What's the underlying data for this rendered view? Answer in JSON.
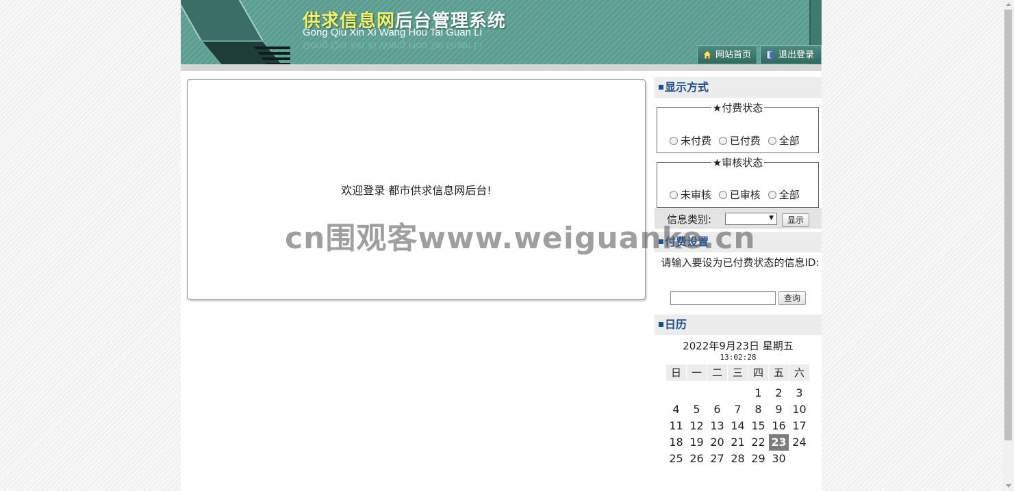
{
  "header": {
    "title_part1": "供求信息网",
    "title_part2": "后台管理系统",
    "subtitle": "Gong Qiu Xin Xi Wang Hou Tai Guan Li",
    "nav": {
      "home": "网站首页",
      "logout": "退出登录"
    }
  },
  "main": {
    "welcome": "欢迎登录 都市供求信息网后台!"
  },
  "sidebar": {
    "display": {
      "heading": "显示方式",
      "pay_group": {
        "legend": "★付费状态",
        "options": [
          "未付费",
          "已付费",
          "全部"
        ]
      },
      "audit_group": {
        "legend": "★审核状态",
        "options": [
          "未审核",
          "已审核",
          "全部"
        ]
      },
      "type_label": "信息类别:",
      "type_selected": "",
      "show_button": "显示"
    },
    "pay_settings": {
      "heading": "付费设置",
      "prompt": "请输入要设为已付费状态的信息ID:",
      "input_value": "",
      "query_button": "查询"
    },
    "calendar": {
      "heading": "日历",
      "date": "2022年9月23日 星期五",
      "time": "13:02:28",
      "weekdays": [
        "日",
        "一",
        "二",
        "三",
        "四",
        "五",
        "六"
      ],
      "weeks": [
        [
          "",
          "",
          "",
          "",
          "1",
          "2",
          "3"
        ],
        [
          "4",
          "5",
          "6",
          "7",
          "8",
          "9",
          "10"
        ],
        [
          "11",
          "12",
          "13",
          "14",
          "15",
          "16",
          "17"
        ],
        [
          "18",
          "19",
          "20",
          "21",
          "22",
          "23",
          "24"
        ],
        [
          "25",
          "26",
          "27",
          "28",
          "29",
          "30",
          ""
        ]
      ],
      "today": "23"
    }
  },
  "watermark": "cn围观客www.weiguanke.cn",
  "colors": {
    "header_green": "#5a9e90",
    "heading_blue": "#1e4f8c",
    "today_bg": "#7d7d7d"
  }
}
